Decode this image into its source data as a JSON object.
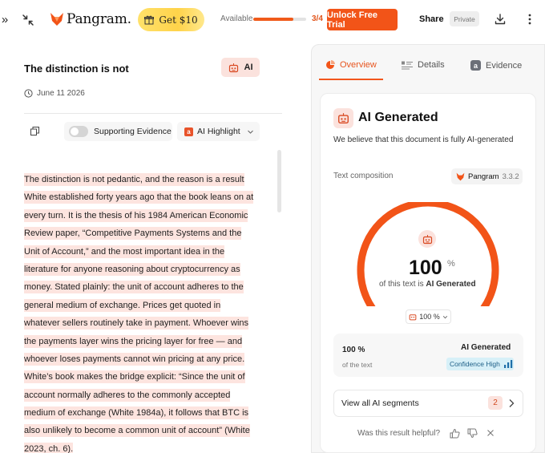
{
  "topbar": {
    "logo_text": "Pangram.",
    "get_button": "Get $10",
    "available_label": "Available",
    "usage": {
      "count_text": "3/4",
      "fraction": 0.75
    },
    "unlock_button": "Unlock Free Trial",
    "share_label": "Share",
    "private_badge": "Private"
  },
  "document": {
    "title": "The distinction is not",
    "ai_badge": "AI",
    "date": "June 11 2026",
    "supporting_evidence_label": "Supporting Evidence",
    "ai_highlight_label": "AI Highlight",
    "lines": [
      "The distinction is not pedantic, and the reason is a result",
      "White established forty years ago that the book leans on at",
      "every turn. It is the thesis of his 1984 American Economic",
      "Review paper, “Competitive Payments Systems and the",
      "Unit of Account,” and the most important idea in the",
      "literature for anyone reasoning about cryptocurrency as",
      "money. Stated plainly: the unit of account adheres to the",
      "general medium of exchange. Prices get quoted in",
      "whatever sellers routinely take in payment. Whoever wins",
      "the payments layer wins the pricing layer for free — and",
      "whoever loses payments cannot win pricing at any price.",
      "White’s book makes the bridge explicit: “Since the unit of",
      "account normally adheres to the commonly accepted",
      "medium of exchange (White 1984a), it follows that BTC is",
      "also unlikely to become a common unit of account” (White",
      "2023, ch. 6)."
    ]
  },
  "panel": {
    "tabs": [
      {
        "label": "Overview",
        "active": true
      },
      {
        "label": "Details",
        "active": false
      },
      {
        "label": "Evidence",
        "active": false
      }
    ],
    "heading": "AI Generated",
    "subheading": "We believe that this document is fully AI-generated",
    "composition_label": "Text composition",
    "model_name": "Pangram",
    "model_version": "3.3.2",
    "gauge": {
      "value": "100",
      "unit": "%",
      "fraction": 1.0,
      "label_prefix": "of this text is",
      "label_strong": "AI Generated"
    },
    "percent_select": "100 %",
    "stats": {
      "percent": "100 %",
      "of_text": "of the text",
      "category": "AI Generated",
      "confidence": "Confidence High"
    },
    "segments_label": "View all AI segments",
    "segments_count": "2",
    "helpful_question": "Was this result helpful?"
  },
  "colors": {
    "accent": "#f25418",
    "highlight": "#fde4df",
    "confidence_bg": "#d7f0f8",
    "get_button": "#ffd34a"
  },
  "icons": [
    "double-chevron-right-icon",
    "collapse-arrows-icon",
    "fox-logo-icon",
    "gift-icon",
    "download-icon",
    "kebab-icon",
    "robot-icon",
    "calendar-clock-icon",
    "copy-icon",
    "chevron-down-icon",
    "details-list-icon",
    "evidence-a-icon",
    "signal-bars-icon",
    "chevron-right-icon",
    "thumbs-up-icon",
    "thumbs-down-icon",
    "close-icon"
  ]
}
